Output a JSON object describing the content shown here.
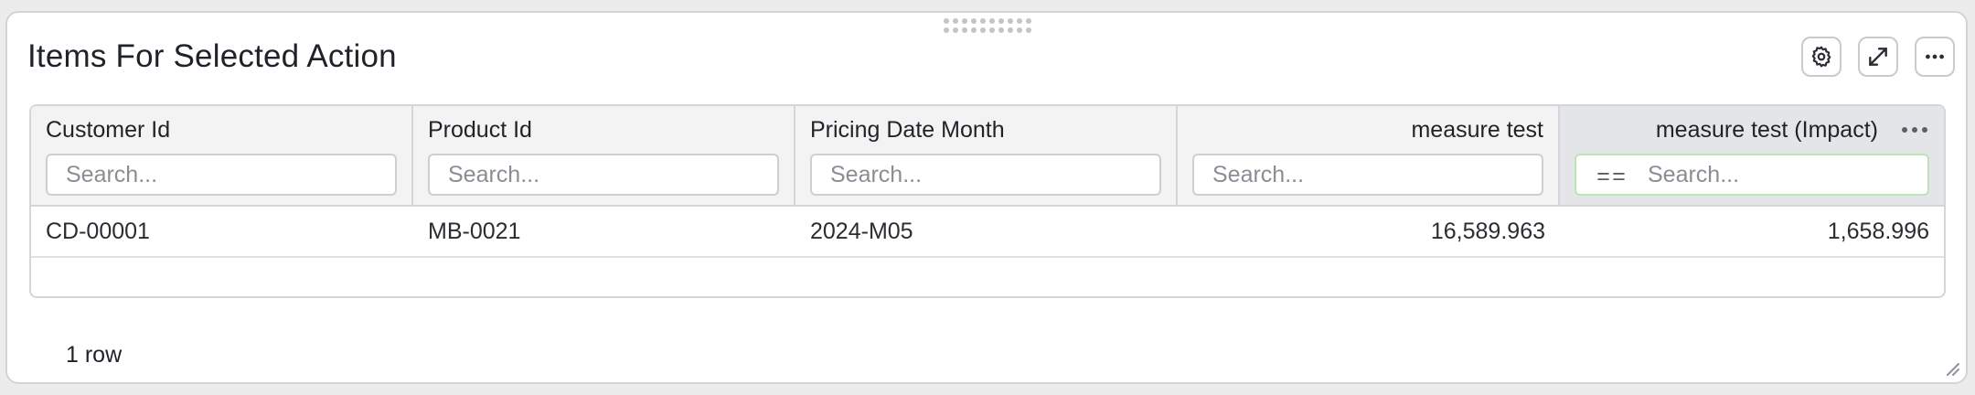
{
  "panel": {
    "title": "Items For Selected Action",
    "toolbar": {
      "settings_icon": "gear-icon",
      "expand_icon": "expand-icon",
      "more_icon": "more-horizontal-icon"
    }
  },
  "table": {
    "columns": [
      {
        "label": "Customer Id",
        "align": "left",
        "placeholder": "Search..."
      },
      {
        "label": "Product Id",
        "align": "left",
        "placeholder": "Search..."
      },
      {
        "label": "Pricing Date Month",
        "align": "left",
        "placeholder": "Search..."
      },
      {
        "label": "measure test",
        "align": "right",
        "placeholder": "Search..."
      },
      {
        "label": "measure test (Impact)",
        "align": "right",
        "placeholder": "Search...",
        "filter_operator": "==",
        "active": true
      }
    ],
    "rows": [
      [
        "CD-00001",
        "MB-0021",
        "2024-M05",
        "16,589.963",
        "1,658.996"
      ]
    ]
  },
  "footer": {
    "row_count": "1 row"
  },
  "colors": {
    "panel_border": "#d3d4d6",
    "header_bg": "#f3f3f4",
    "active_header_bg": "#e4e5e8",
    "active_filter_border": "#bfe3b6"
  }
}
